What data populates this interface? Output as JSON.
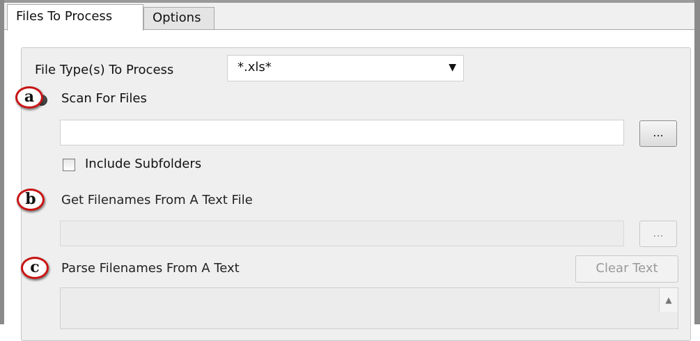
{
  "tabs": [
    {
      "label": "Files To Process",
      "active": true
    },
    {
      "label": "Options",
      "active": false
    }
  ],
  "file_types": {
    "label": "File Type(s) To Process",
    "value": "*.xls*",
    "icon": "chevron-down-icon"
  },
  "scan": {
    "badge": "a",
    "label": "Scan For Files",
    "browse_label": "...",
    "include_subfolders_label": "Include Subfolders"
  },
  "textfile": {
    "badge": "b",
    "label": "Get Filenames From A Text File",
    "browse_label": "..."
  },
  "parse": {
    "badge": "c",
    "label": "Parse Filenames From A Text",
    "clear_label": "Clear Text"
  },
  "colors": {
    "badge_ring": "#c81414",
    "panel_bg": "#efefef",
    "disabled_text": "#9a9a9a"
  }
}
